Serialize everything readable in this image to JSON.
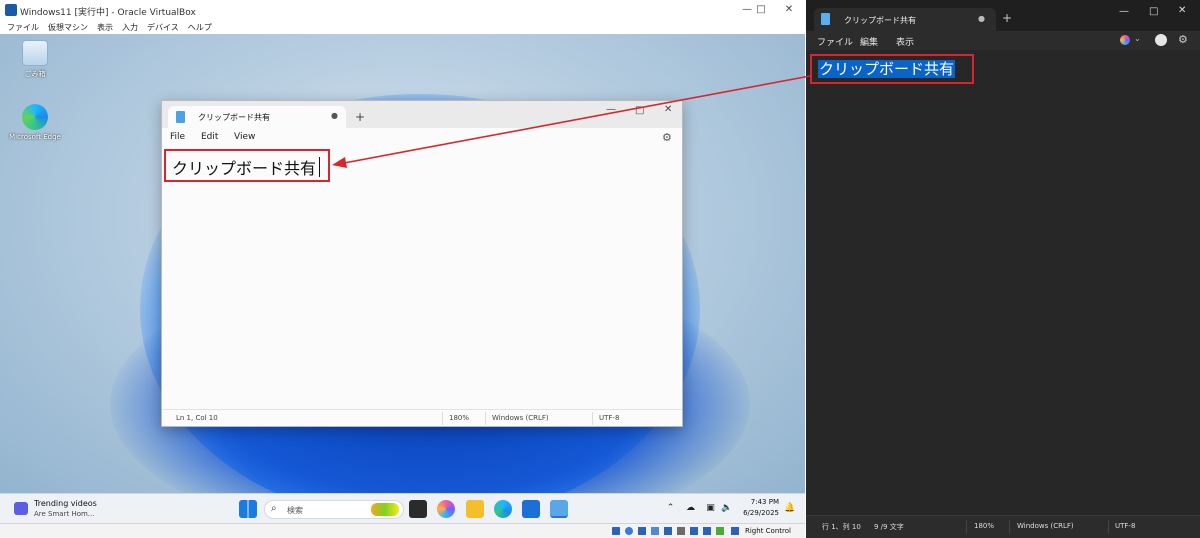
{
  "vbox": {
    "title": "Windows11 [実行中] - Oracle VirtualBox",
    "menu": [
      "ファイル",
      "仮想マシン",
      "表示",
      "入力",
      "デバイス",
      "ヘルプ"
    ],
    "host_key": "Right Control"
  },
  "desktop": {
    "icons": [
      {
        "label": "ごみ箱",
        "icon": "recycle-bin-icon"
      },
      {
        "label": "Microsoft Edge",
        "icon": "edge-icon"
      }
    ]
  },
  "guest_notepad": {
    "tab_title": "クリップボード共有",
    "menu": [
      "File",
      "Edit",
      "View"
    ],
    "content": "クリップボード共有",
    "status": {
      "position": "Ln 1, Col 10",
      "zoom": "180%",
      "line_ending": "Windows (CRLF)",
      "encoding": "UTF-8"
    }
  },
  "guest_taskbar": {
    "widget_title": "Trending videos",
    "widget_subtitle": "Are Smart Hom...",
    "search_placeholder": "検索",
    "time": "7:43 PM",
    "date": "6/29/2025"
  },
  "host_notepad": {
    "tab_title": "クリップボード共有",
    "menu": [
      "ファイル",
      "編集",
      "表示"
    ],
    "content": "クリップボード共有",
    "status": {
      "position": "行 1、列 10",
      "selection": "9 /9 文字",
      "zoom": "180%",
      "line_ending": "Windows (CRLF)",
      "encoding": "UTF-8"
    }
  },
  "colors": {
    "annotation_red": "#d8262e",
    "selection_blue": "#0a64c8",
    "host_dark_bg": "#272727"
  }
}
